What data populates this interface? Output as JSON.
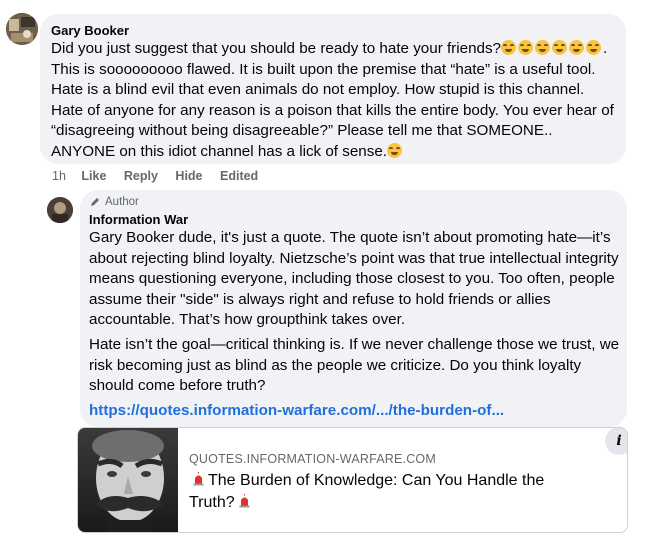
{
  "comment": {
    "author": "Gary Booker",
    "text_line1": "Did you just suggest that you should be ready to hate your friends?",
    "text_rest": "This is sooooooooo flawed. It is built upon the premise that “hate” is a useful tool. Hate is a blind evil that even animals do not employ. How stupid is this channel. Hate of anyone for any reason is a poison that kills the entire body. You ever hear of “disagreeing without being disagreeable?” Please tell me that SOMEONE.. ANYONE on this idiot channel has a lick of sense.",
    "emoji_name": "grimacing-face-emoji",
    "time": "1h",
    "like": "Like",
    "reply": "Reply",
    "hide": "Hide",
    "edited": "Edited"
  },
  "reply": {
    "badge": "Author",
    "author": "Information War",
    "paragraph1": "Gary Booker dude, it's just a quote. The quote isn’t about promoting hate—it’s about rejecting blind loyalty. Nietzsche’s point was that true intellectual integrity means questioning everyone, including those closest to you. Too often, people assume their \"side\" is always right and refuse to hold friends or allies accountable. That’s how groupthink takes over.",
    "paragraph2": "Hate isn’t the goal—critical thinking is. If we never challenge those we trust, we risk becoming just as blind as the people we criticize. Do you think loyalty should come before truth?",
    "link": "https://quotes.information-warfare.com/.../the-burden-of...",
    "card": {
      "domain": "QUOTES.INFORMATION-WARFARE.COM",
      "title": "The Burden of Knowledge: Can You Handle the Truth?",
      "info_icon": "i"
    }
  },
  "colors": {
    "bubble": "#f0f2f5",
    "link": "#216fdb",
    "meta": "#65676b",
    "siren": "#e0312b"
  }
}
